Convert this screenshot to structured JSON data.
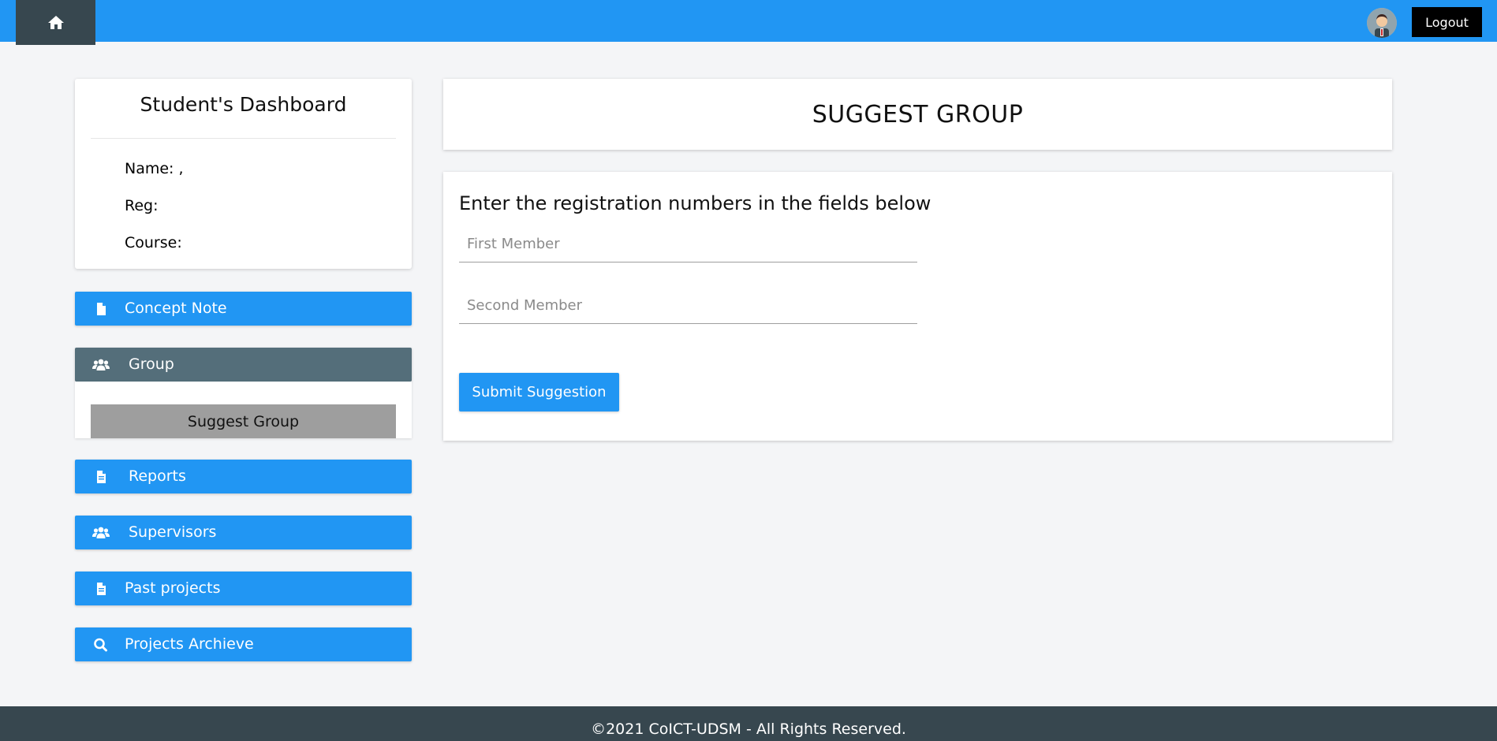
{
  "header": {
    "home_icon": "home-icon",
    "avatar_icon": "user-avatar",
    "logout_label": "Logout",
    "brand_color": "#2196f3"
  },
  "profile": {
    "title": "Student's Dashboard",
    "name_label": "Name: ,",
    "reg_label": "Reg:",
    "course_label": "Course:"
  },
  "sidebar": {
    "items": [
      {
        "label": "Concept Note",
        "icon": "file-icon"
      },
      {
        "label": "Group",
        "icon": "users-icon",
        "active": true
      },
      {
        "label": "Reports",
        "icon": "file-icon"
      },
      {
        "label": "Supervisors",
        "icon": "users-icon"
      },
      {
        "label": "Past projects",
        "icon": "file-icon"
      },
      {
        "label": "Projects Archieve",
        "icon": "search-icon"
      }
    ],
    "group_submenu": [
      {
        "label": "Suggest Group"
      }
    ]
  },
  "main": {
    "page_title": "SUGGEST GROUP",
    "form": {
      "heading": "Enter the registration numbers in the fields below",
      "first_placeholder": "First Member",
      "second_placeholder": "Second Member",
      "first_value": "",
      "second_value": "",
      "submit_label": "Submit Suggestion"
    }
  },
  "footer": {
    "text": "©2021 CoICT-UDSM - All Rights Reserved."
  }
}
